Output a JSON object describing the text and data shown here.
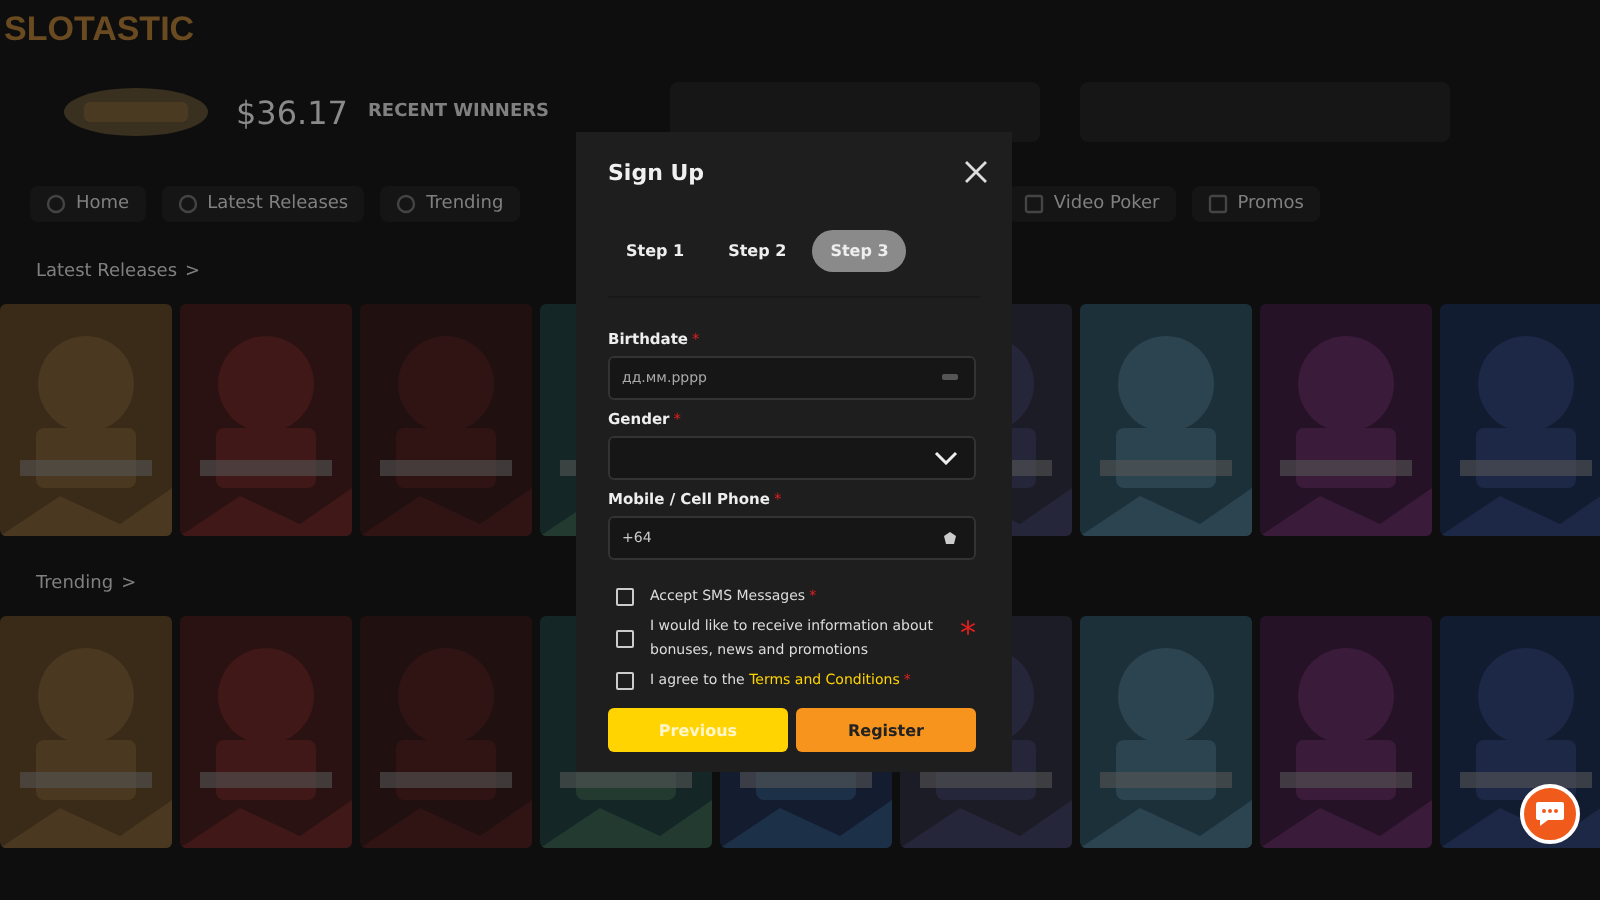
{
  "site": {
    "logo": "SLOTASTIC",
    "jackpot": "$36.17",
    "winners_label": "RECENT WINNERS"
  },
  "nav": {
    "left": [
      "Home",
      "Latest Releases",
      "Trending"
    ],
    "right": [
      "Video Poker",
      "Promos"
    ]
  },
  "sections": [
    {
      "title": "Latest Releases",
      "arrow": ">"
    },
    {
      "title": "Trending",
      "arrow": ">"
    }
  ],
  "dialog": {
    "title": "Sign Up",
    "steps": [
      {
        "label": "Step 1",
        "selected": false
      },
      {
        "label": "Step 2",
        "selected": false
      },
      {
        "label": "Step 3",
        "selected": true
      }
    ],
    "fields": [
      {
        "kind": "date",
        "label": "Birthdate",
        "required_mark": "*",
        "placeholder": "дд.мм.рррр"
      },
      {
        "kind": "select",
        "label": "Gender",
        "required_mark": "*"
      },
      {
        "kind": "phone",
        "label": "Mobile / Cell Phone",
        "required_mark": "*",
        "value": "+64"
      }
    ],
    "checkboxes": [
      {
        "text": "Accept SMS Messages",
        "required_mark": "*",
        "checked": false
      },
      {
        "text": "I would like to receive information about bonuses, news and promotions",
        "side_mark": "*",
        "checked": false
      },
      {
        "text": "I agree to the ",
        "link": "Terms and Conditions",
        "required_mark": "*",
        "checked": false
      }
    ],
    "buttons": [
      {
        "kind": "secondary",
        "label": "Previous"
      },
      {
        "kind": "primary",
        "label": "Register"
      }
    ]
  }
}
